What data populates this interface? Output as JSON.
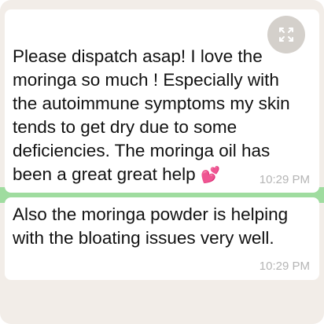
{
  "messages": [
    {
      "text_before_emoji": "Please dispatch asap! I love the\nmoringa so much ! Especially with\nthe autoimmune symptoms my skin\ntends to get dry due to some\ndeficiencies. The moringa oil has\nbeen a great great help ",
      "emoji": "💕",
      "time": "10:29 PM"
    },
    {
      "text": "Also the moringa powder is helping\nwith the bloating issues very well.",
      "time": "10:29 PM"
    }
  ],
  "icons": {
    "expand": "expand-icon"
  },
  "colors": {
    "background": "#f2ede8",
    "bubble": "#ffffff",
    "timestamp": "#b5b5b5",
    "accent_strip": "#9fdc9f",
    "expand_button": "#d4d0cb"
  }
}
